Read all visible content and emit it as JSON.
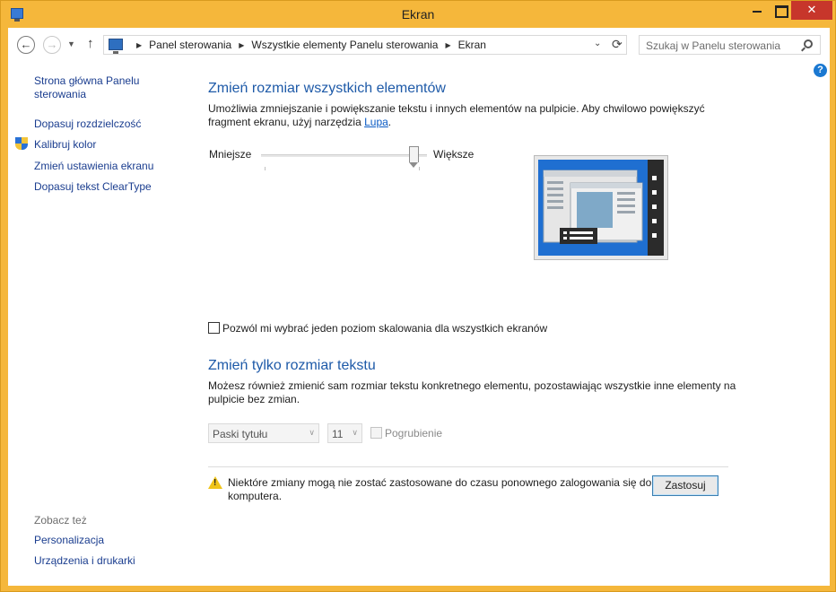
{
  "window": {
    "title": "Ekran"
  },
  "navigation": {
    "back_label": "←",
    "forward_label": "→",
    "recent_label": "▼",
    "up_label": "↑",
    "breadcrumb": [
      "Panel sterowania",
      "Wszystkie elementy Panelu sterowania",
      "Ekran"
    ],
    "dropdown_label": "⌄",
    "refresh_label": "⟳",
    "search_placeholder": "Szukaj w Panelu sterowania"
  },
  "help_label": "?",
  "left_pane": {
    "links": [
      "Strona główna Panelu sterowania",
      "Dopasuj rozdzielczość",
      "Kalibruj kolor",
      "Zmień ustawienia ekranu",
      "Dopasuj tekst ClearType"
    ],
    "see_also_heading": "Zobacz też",
    "see_also_links": [
      "Personalizacja",
      "Urządzenia i drukarki"
    ]
  },
  "scaling": {
    "heading": "Zmień rozmiar wszystkich elementów",
    "description_prefix": "Umożliwia zmniejszanie i powiększanie tekstu i innych elementów na pulpicie. Aby chwilowo powiększyć fragment ekranu, użyj narzędzia ",
    "description_link": "Lupa",
    "description_suffix": ".",
    "slider_min_label": "Mniejsze",
    "slider_max_label": "Większe",
    "slider_value_fraction": 0.95,
    "single_level_checkbox_label": "Pozwól mi wybrać jeden poziom skalowania dla wszystkich ekranów",
    "single_level_checked": false
  },
  "text_size": {
    "heading": "Zmień tylko rozmiar tekstu",
    "description": "Możesz również zmienić sam rozmiar tekstu konkretnego elementu, pozostawiając wszystkie inne elementy na pulpicie bez zmian.",
    "element_select_value": "Paski tytułu",
    "size_select_value": "11",
    "bold_label": "Pogrubienie",
    "bold_checked": false
  },
  "notice": {
    "text": "Niektóre zmiany mogą nie zostać zastosowane do czasu ponownego zalogowania się do komputera.",
    "apply_label": "Zastosuj"
  },
  "colors": {
    "title_bar": "#f5b73b",
    "close_button": "#c7362b",
    "heading": "#1e5aa8",
    "link": "#1a3d8f"
  },
  "icons": {
    "app": "monitor-icon",
    "address": "control-panel-icon",
    "search": "search-icon",
    "help": "help-icon",
    "calibrate": "uac-shield-icon",
    "warning": "warning-icon"
  }
}
